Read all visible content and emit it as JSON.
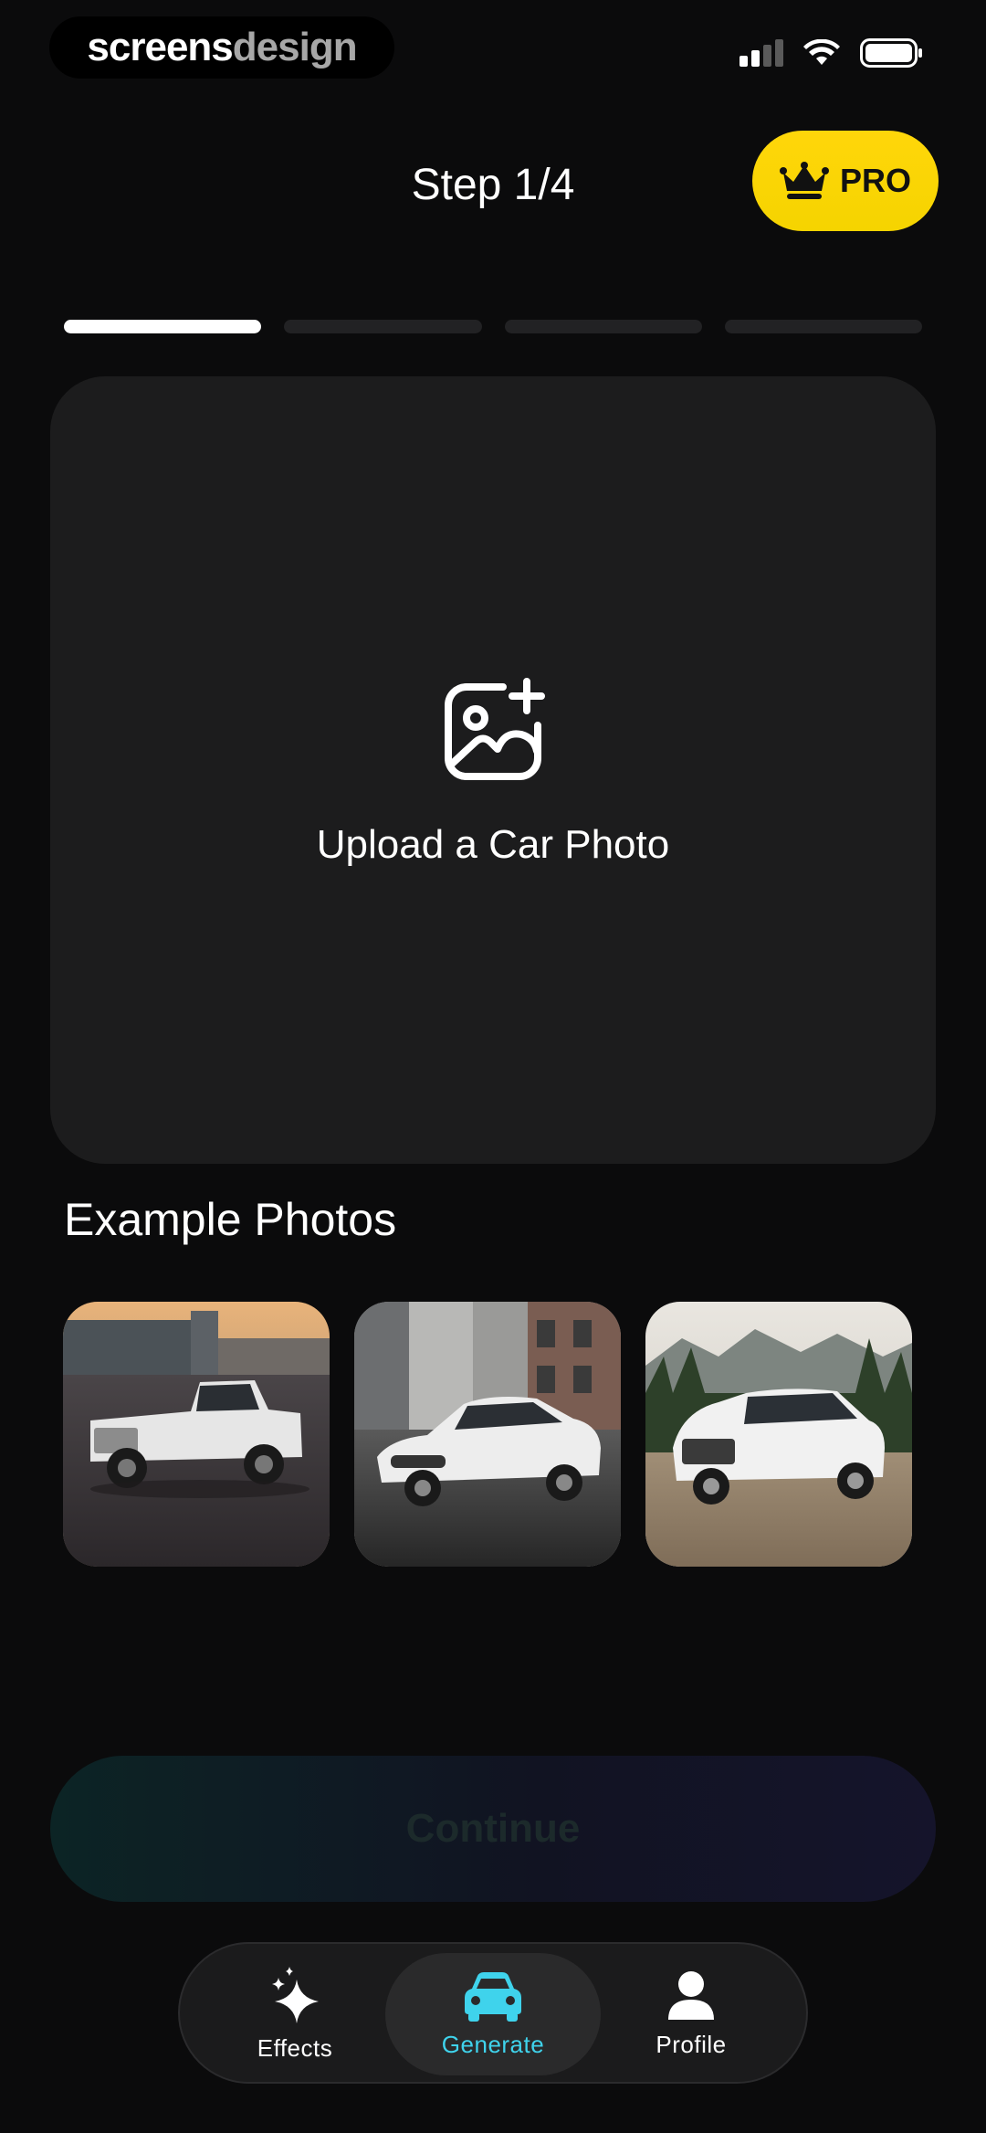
{
  "status_bar": {
    "brand_part1": "screens",
    "brand_part2": "design",
    "icons": [
      "cellular-signal-icon",
      "wifi-icon",
      "battery-icon"
    ]
  },
  "header": {
    "step_title": "Step 1/4",
    "pro_label": "PRO",
    "pro_icon": "crown-icon",
    "pro_color": "#FFD60A"
  },
  "progress": {
    "current_step": 1,
    "total_steps": 4
  },
  "upload": {
    "icon": "add-photo-icon",
    "label": "Upload a Car Photo"
  },
  "examples": {
    "title": "Example Photos",
    "photos": [
      {
        "name": "white-pickup-truck-photo"
      },
      {
        "name": "white-sedan-photo"
      },
      {
        "name": "white-suv-mountain-photo"
      }
    ]
  },
  "continue": {
    "label": "Continue",
    "enabled": false
  },
  "tabbar": {
    "accent": "#3FD3EC",
    "tabs": [
      {
        "label": "Effects",
        "icon": "sparkles-icon",
        "active": false
      },
      {
        "label": "Generate",
        "icon": "car-icon",
        "active": true
      },
      {
        "label": "Profile",
        "icon": "person-icon",
        "active": false
      }
    ]
  }
}
